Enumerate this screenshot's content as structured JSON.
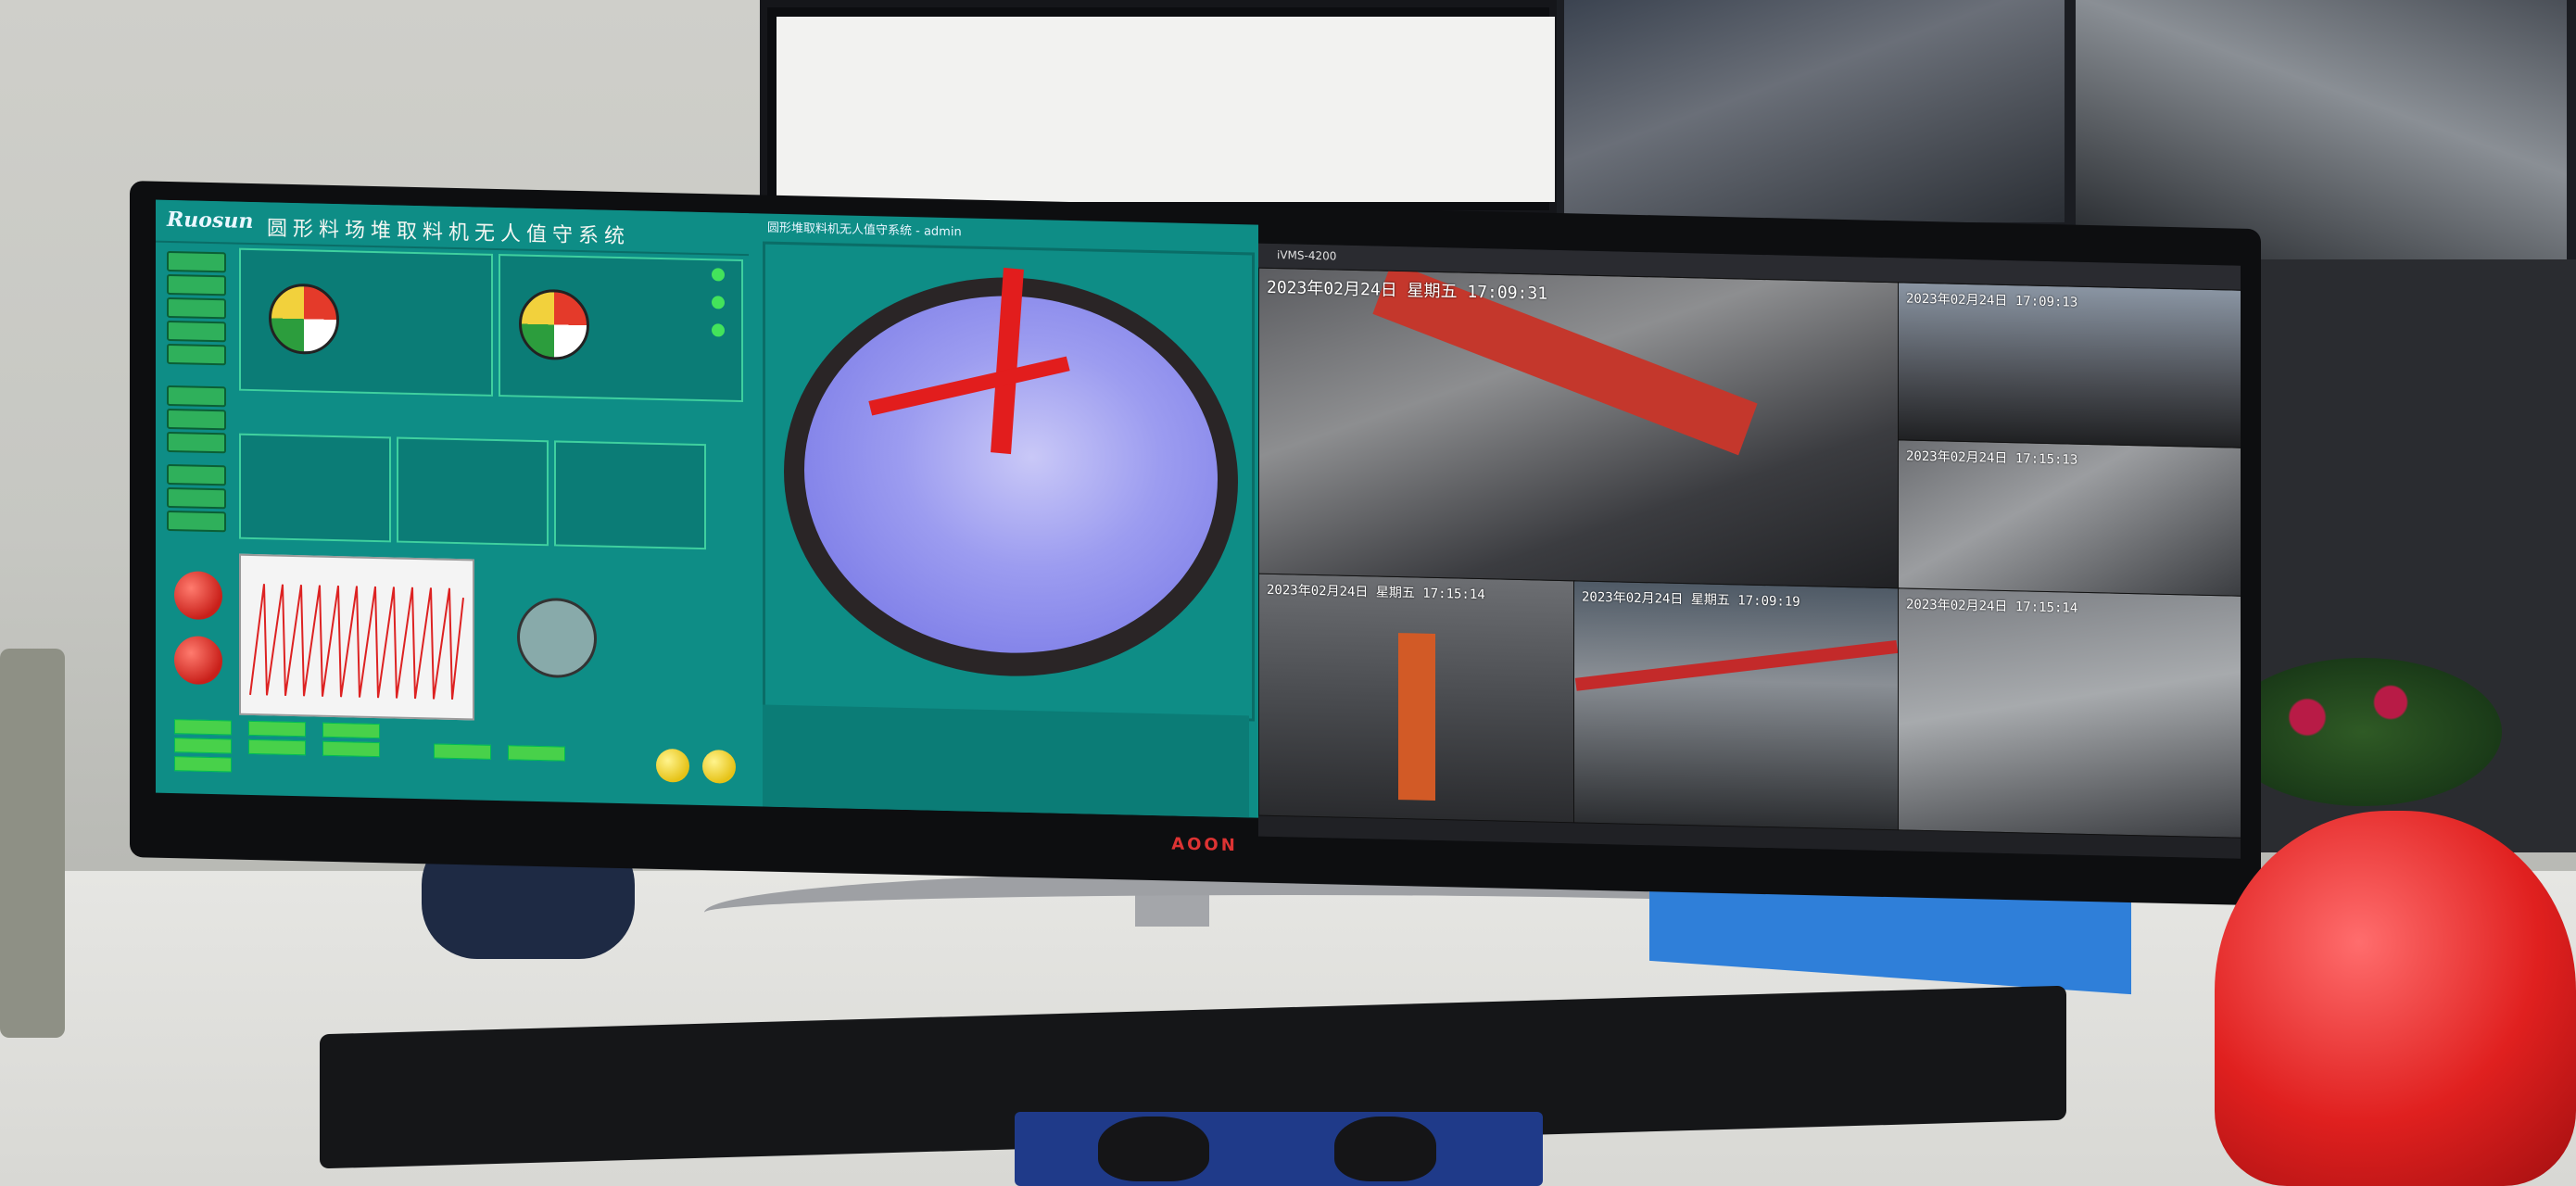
{
  "left_app": {
    "logo": "Ruosun",
    "title": "圆形料场堆取料机无人值守系统"
  },
  "viewer": {
    "title": "圆形堆取料机无人值守系统 - admin"
  },
  "camera_app": {
    "title": "iVMS-4200",
    "timestamps": [
      "2023年02月24日 星期五 17:09:31",
      "2023年02月24日 17:09:13",
      "2023年02月24日 17:15:13",
      "2023年02月24日 星期五 17:15:14",
      "2023年02月24日 星期五 17:09:19",
      "2023年02月24日 17:15:14"
    ]
  },
  "monitor_brand": "AOON"
}
